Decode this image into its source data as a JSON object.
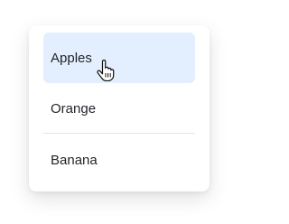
{
  "menu": {
    "items": [
      {
        "label": "Apples",
        "state": "hovered"
      },
      {
        "label": "Orange",
        "state": "normal"
      },
      {
        "label": "Banana",
        "state": "normal"
      }
    ]
  },
  "colors": {
    "hover_background": "#e3efff",
    "text": "#1f2328",
    "divider": "#e1e4e8"
  },
  "cursor": {
    "icon": "hand-pointer-icon"
  }
}
